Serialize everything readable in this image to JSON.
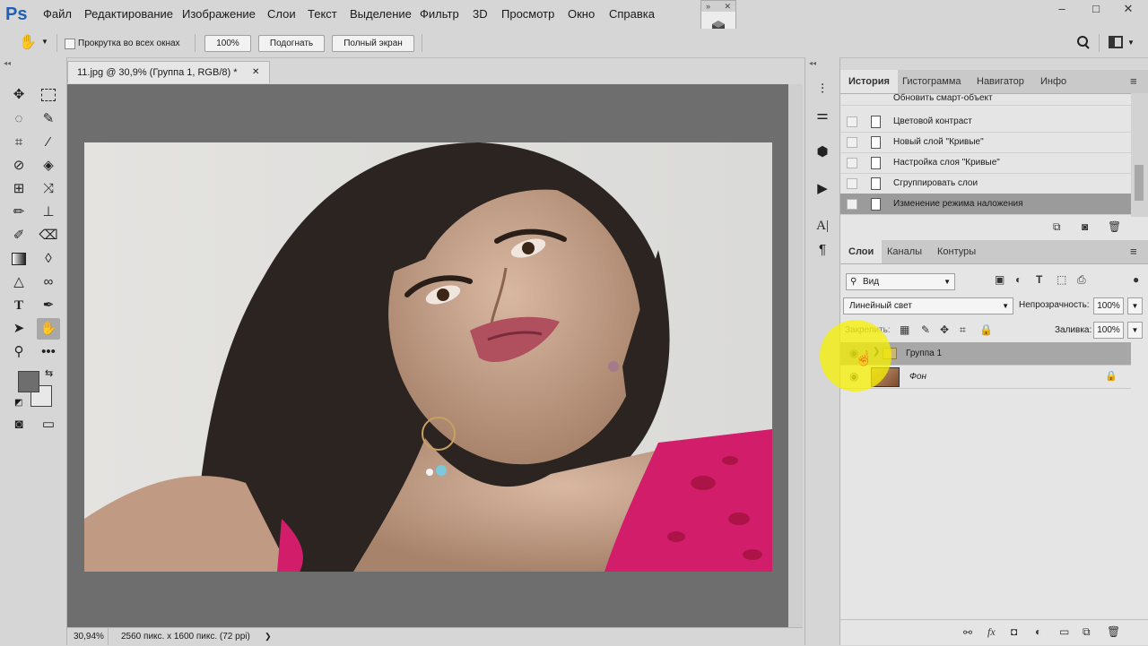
{
  "app": {
    "logo": "Ps",
    "menus": [
      "Файл",
      "Редактирование",
      "Изображение",
      "Слои",
      "Текст",
      "Выделение",
      "Фильтр",
      "3D",
      "Просмотр",
      "Окно",
      "Справка"
    ],
    "window_controls": [
      "–",
      "□",
      "✕"
    ]
  },
  "options_bar": {
    "tool_icon": "hand-icon",
    "scroll_all_label": "Прокрутка во всех окнах",
    "zoom_100_label": "100%",
    "fit_label": "Подогнать",
    "fullscreen_label": "Полный экран"
  },
  "document": {
    "tab_title": "11.jpg @ 30,9% (Группа 1, RGB/8) *",
    "zoom": "30,94%",
    "status_info": "2560 пикс. x 1600 пикс. (72 ppi)"
  },
  "history_panel": {
    "tabs": [
      "История",
      "Гистограмма",
      "Навигатор",
      "Инфо"
    ],
    "items": [
      "Обновить смарт-объект",
      "Цветовой контраст",
      "Новый слой \"Кривые\"",
      "Настройка слоя \"Кривые\"",
      "Сгруппировать слои",
      "Изменение режима наложения"
    ]
  },
  "layers_panel": {
    "tabs": [
      "Слои",
      "Каналы",
      "Контуры"
    ],
    "filter_label": "Вид",
    "blend_mode": "Линейный свет",
    "opacity_label": "Непрозрачность:",
    "opacity_value": "100%",
    "lock_label": "Закрепить:",
    "fill_label": "Заливка:",
    "fill_value": "100%",
    "layers": [
      {
        "name": "Группа 1"
      },
      {
        "name": "Фон"
      }
    ]
  },
  "colors": {
    "accent": "#1f5fb8",
    "foreground": "#6e6e6e",
    "background": "#e8e8e8",
    "cursor_highlight": "#f5f000"
  }
}
